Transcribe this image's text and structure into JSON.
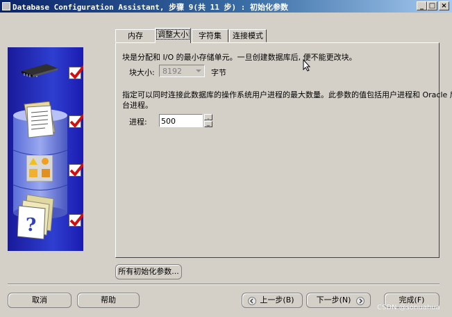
{
  "window": {
    "title": "Database Configuration Assistant, 步骤 9(共 11 步) : 初始化参数"
  },
  "tabs": [
    {
      "label": "内存"
    },
    {
      "label": "调整大小"
    },
    {
      "label": "字符集"
    },
    {
      "label": "连接模式"
    }
  ],
  "sizing": {
    "block_desc": "块是分配和 I/O 的最小存储单元。一旦创建数据库后, 便不能更改块。",
    "block_label": "块大小:",
    "block_value": "8192",
    "block_unit": "字节",
    "process_desc_line1": "指定可以同时连接此数据库的操作系统用户进程的最大数量。此参数的值包括用户进程和 Oracle 后",
    "process_desc_line2": "台进程。",
    "process_label": "进程:",
    "process_value": "500"
  },
  "buttons": {
    "all_params": "所有初始化参数...",
    "cancel": "取消",
    "help": "帮助",
    "back": "上一步(B)",
    "next": "下一步(N)",
    "finish": "完成(F)"
  },
  "watermark": "CSDN @sonuahua",
  "colors": {
    "titlebar_start": "#0a246a",
    "illustration_bg": "#2e3fd0",
    "check_red": "#d01010"
  }
}
